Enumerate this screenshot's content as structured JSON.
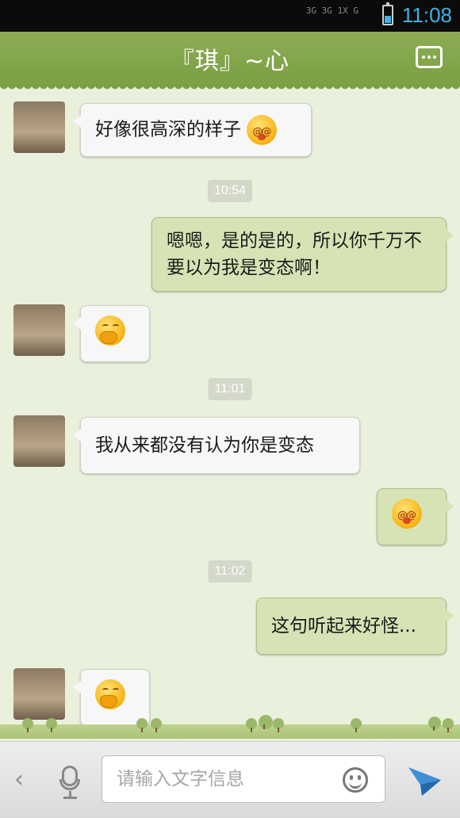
{
  "status_bar": {
    "network": "3G 3G 1X G",
    "time": "11:08"
  },
  "header": {
    "title": "『琪』~心"
  },
  "messages": [
    {
      "side": "in",
      "text": "好像很高深的样子",
      "emoji": "dizzy"
    },
    {
      "type": "time",
      "text": "10:54"
    },
    {
      "side": "out",
      "text": "嗯嗯，是的是的，所以你千万不要以为我是变态啊！"
    },
    {
      "side": "in",
      "emoji": "shy"
    },
    {
      "type": "time",
      "text": "11:01"
    },
    {
      "side": "in",
      "text": "我从来都没有认为你是变态"
    },
    {
      "side": "out",
      "emoji": "dizzy"
    },
    {
      "type": "time",
      "text": "11:02"
    },
    {
      "side": "out",
      "text": "这句听起来好怪..."
    },
    {
      "side": "in",
      "emoji": "shy"
    }
  ],
  "input": {
    "placeholder": "请输入文字信息"
  },
  "icons": {
    "back": "chevron-left-icon",
    "voice": "microphone-icon",
    "emoji": "smiley-icon",
    "send": "send-icon"
  },
  "colors": {
    "header": "#7c9f44",
    "incoming_bubble": "#f7f7f7",
    "outgoing_bubble": "#d6e4b5",
    "status_time": "#3db3e6"
  }
}
